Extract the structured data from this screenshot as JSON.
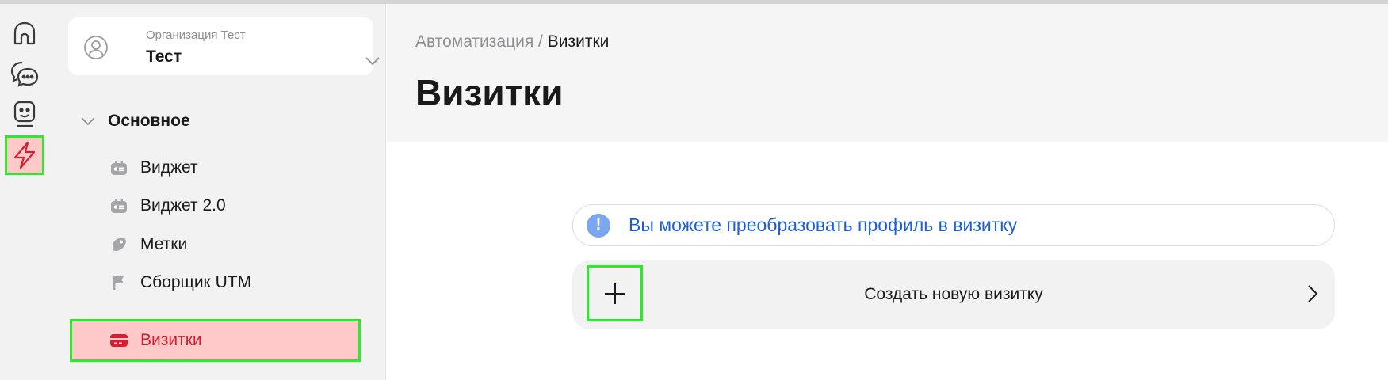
{
  "rail": {
    "items": [
      {
        "icon": "home-icon",
        "active": false
      },
      {
        "icon": "chat-icon",
        "active": false
      },
      {
        "icon": "bot-icon",
        "active": false
      },
      {
        "icon": "lightning-icon",
        "active": true
      }
    ]
  },
  "org": {
    "subtitle": "Организация Тест",
    "name": "Тест"
  },
  "sidebar": {
    "section_label": "Основное",
    "items": [
      {
        "label": "Виджет",
        "icon": "widget-icon"
      },
      {
        "label": "Виджет 2.0",
        "icon": "widget-icon"
      },
      {
        "label": "Метки",
        "icon": "tag-icon"
      },
      {
        "label": "Сборщик UTM",
        "icon": "flag-icon"
      },
      {
        "label": "Визитки",
        "icon": "card-icon",
        "active": true
      }
    ]
  },
  "breadcrumb": {
    "parent": "Автоматизация",
    "separator": " / ",
    "current": "Визитки"
  },
  "page": {
    "title": "Визитки"
  },
  "info": {
    "text": "Вы можете преобразовать профиль в визитку"
  },
  "create": {
    "label": "Создать новую визитку"
  },
  "colors": {
    "accent": "#d42030",
    "active_bg": "#ffc9c9",
    "highlight_outline": "#2ee82e",
    "info_blue": "#1e5fd6"
  }
}
